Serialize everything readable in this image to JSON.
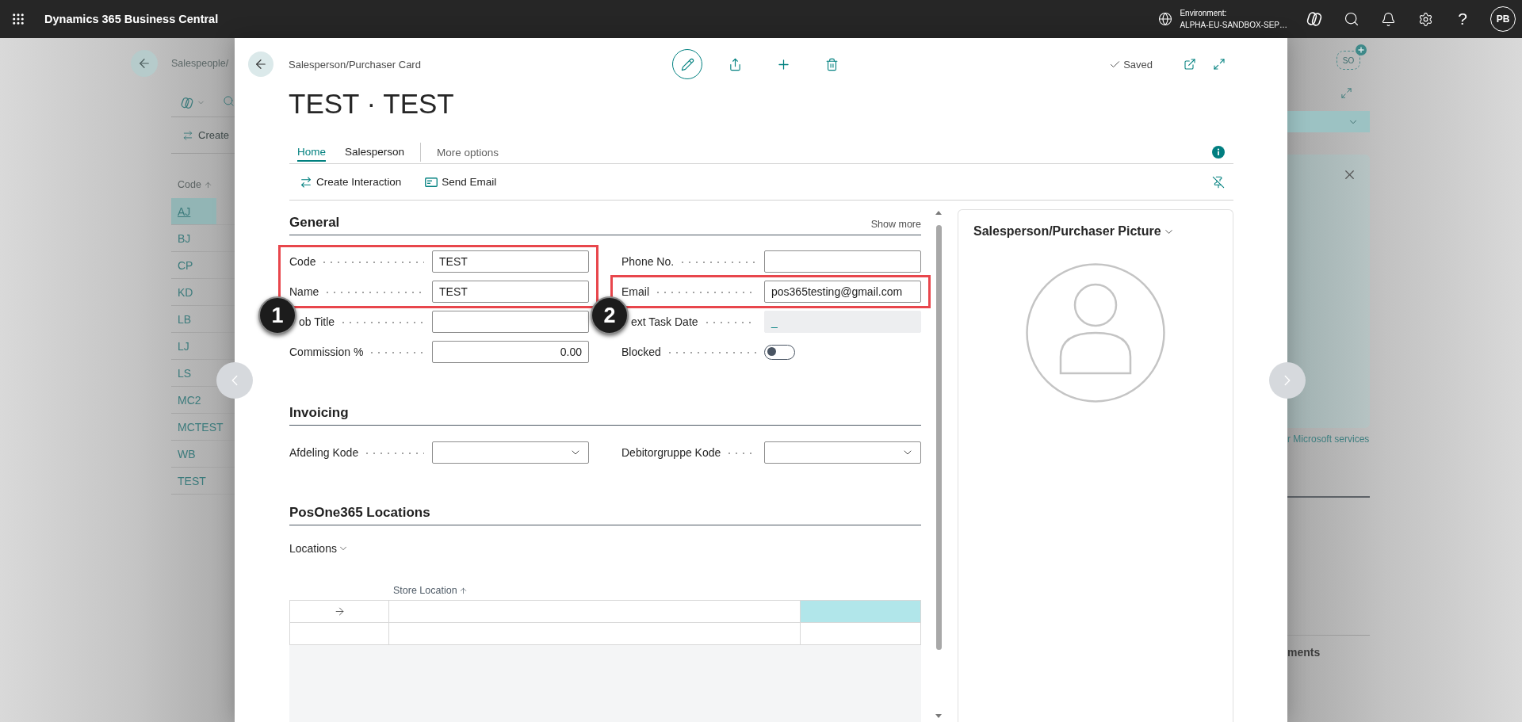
{
  "app_bar": {
    "title": "Dynamics 365 Business Central",
    "environment_label": "Environment:",
    "environment_name": "ALPHA-EU-SANDBOX-SEP…",
    "help": "?",
    "avatar": "PB"
  },
  "list_page": {
    "breadcrumb": "Salespeople/",
    "action": "Create",
    "column": "Code",
    "rows": [
      {
        "code": "AJ",
        "selected": true
      },
      {
        "code": "BJ",
        "selected": false
      },
      {
        "code": "CP",
        "selected": false
      },
      {
        "code": "KD",
        "selected": false
      },
      {
        "code": "LB",
        "selected": false
      },
      {
        "code": "LJ",
        "selected": false
      },
      {
        "code": "LS",
        "selected": false
      },
      {
        "code": "MC2",
        "selected": false
      },
      {
        "code": "MCTEST",
        "selected": false
      },
      {
        "code": "WB",
        "selected": false
      },
      {
        "code": "TEST",
        "selected": false
      }
    ],
    "agent_badge": "SO",
    "factbox_link": "r Microsoft services",
    "factbox_heading": "ments"
  },
  "card": {
    "breadcrumb": "Salesperson/Purchaser Card",
    "status": "Saved",
    "title": "TEST · TEST",
    "tabs": [
      {
        "label": "Home",
        "selected": true
      },
      {
        "label": "Salesperson",
        "selected": false
      }
    ],
    "more_options": "More options",
    "actions": [
      {
        "label": "Create Interaction",
        "kind": "interaction"
      },
      {
        "label": "Send Email",
        "kind": "email"
      }
    ],
    "general": {
      "title": "General",
      "show_more": "Show more",
      "columns": [
        [
          {
            "callout": "1",
            "fields": [
              {
                "label": "Code",
                "value": "TEST",
                "kind": "text"
              },
              {
                "label": "Name",
                "value": "TEST",
                "kind": "text"
              }
            ]
          },
          {
            "fields": [
              {
                "label": "ob Title",
                "kind": "text"
              },
              {
                "label": "Commission %",
                "value": "0.00",
                "kind": "number"
              }
            ]
          }
        ],
        [
          {
            "fields": [
              {
                "label": "Phone No.",
                "kind": "text"
              }
            ]
          },
          {
            "callout": "2",
            "fields": [
              {
                "label": "Email",
                "value": "pos365testing@gmail.com",
                "kind": "text"
              }
            ]
          },
          {
            "fields": [
              {
                "label": "ext Task Date",
                "value": "_",
                "kind": "readonly"
              },
              {
                "label": "Blocked",
                "kind": "toggle",
                "on": false
              }
            ]
          }
        ]
      ]
    },
    "invoicing": {
      "title": "Invoicing",
      "columns": [
        [
          {
            "fields": [
              {
                "label": "Afdeling Kode",
                "kind": "dropdown"
              }
            ]
          }
        ],
        [
          {
            "fields": [
              {
                "label": "Debitorgruppe Kode",
                "kind": "dropdown"
              }
            ]
          }
        ]
      ]
    },
    "locations": {
      "title": "PosOne365 Locations",
      "subpart": "Locations",
      "column": "Store Location",
      "rows": [
        {
          "selected": true
        },
        {
          "selected": false
        }
      ]
    },
    "picture": {
      "title": "Salesperson/Purchaser Picture"
    }
  }
}
